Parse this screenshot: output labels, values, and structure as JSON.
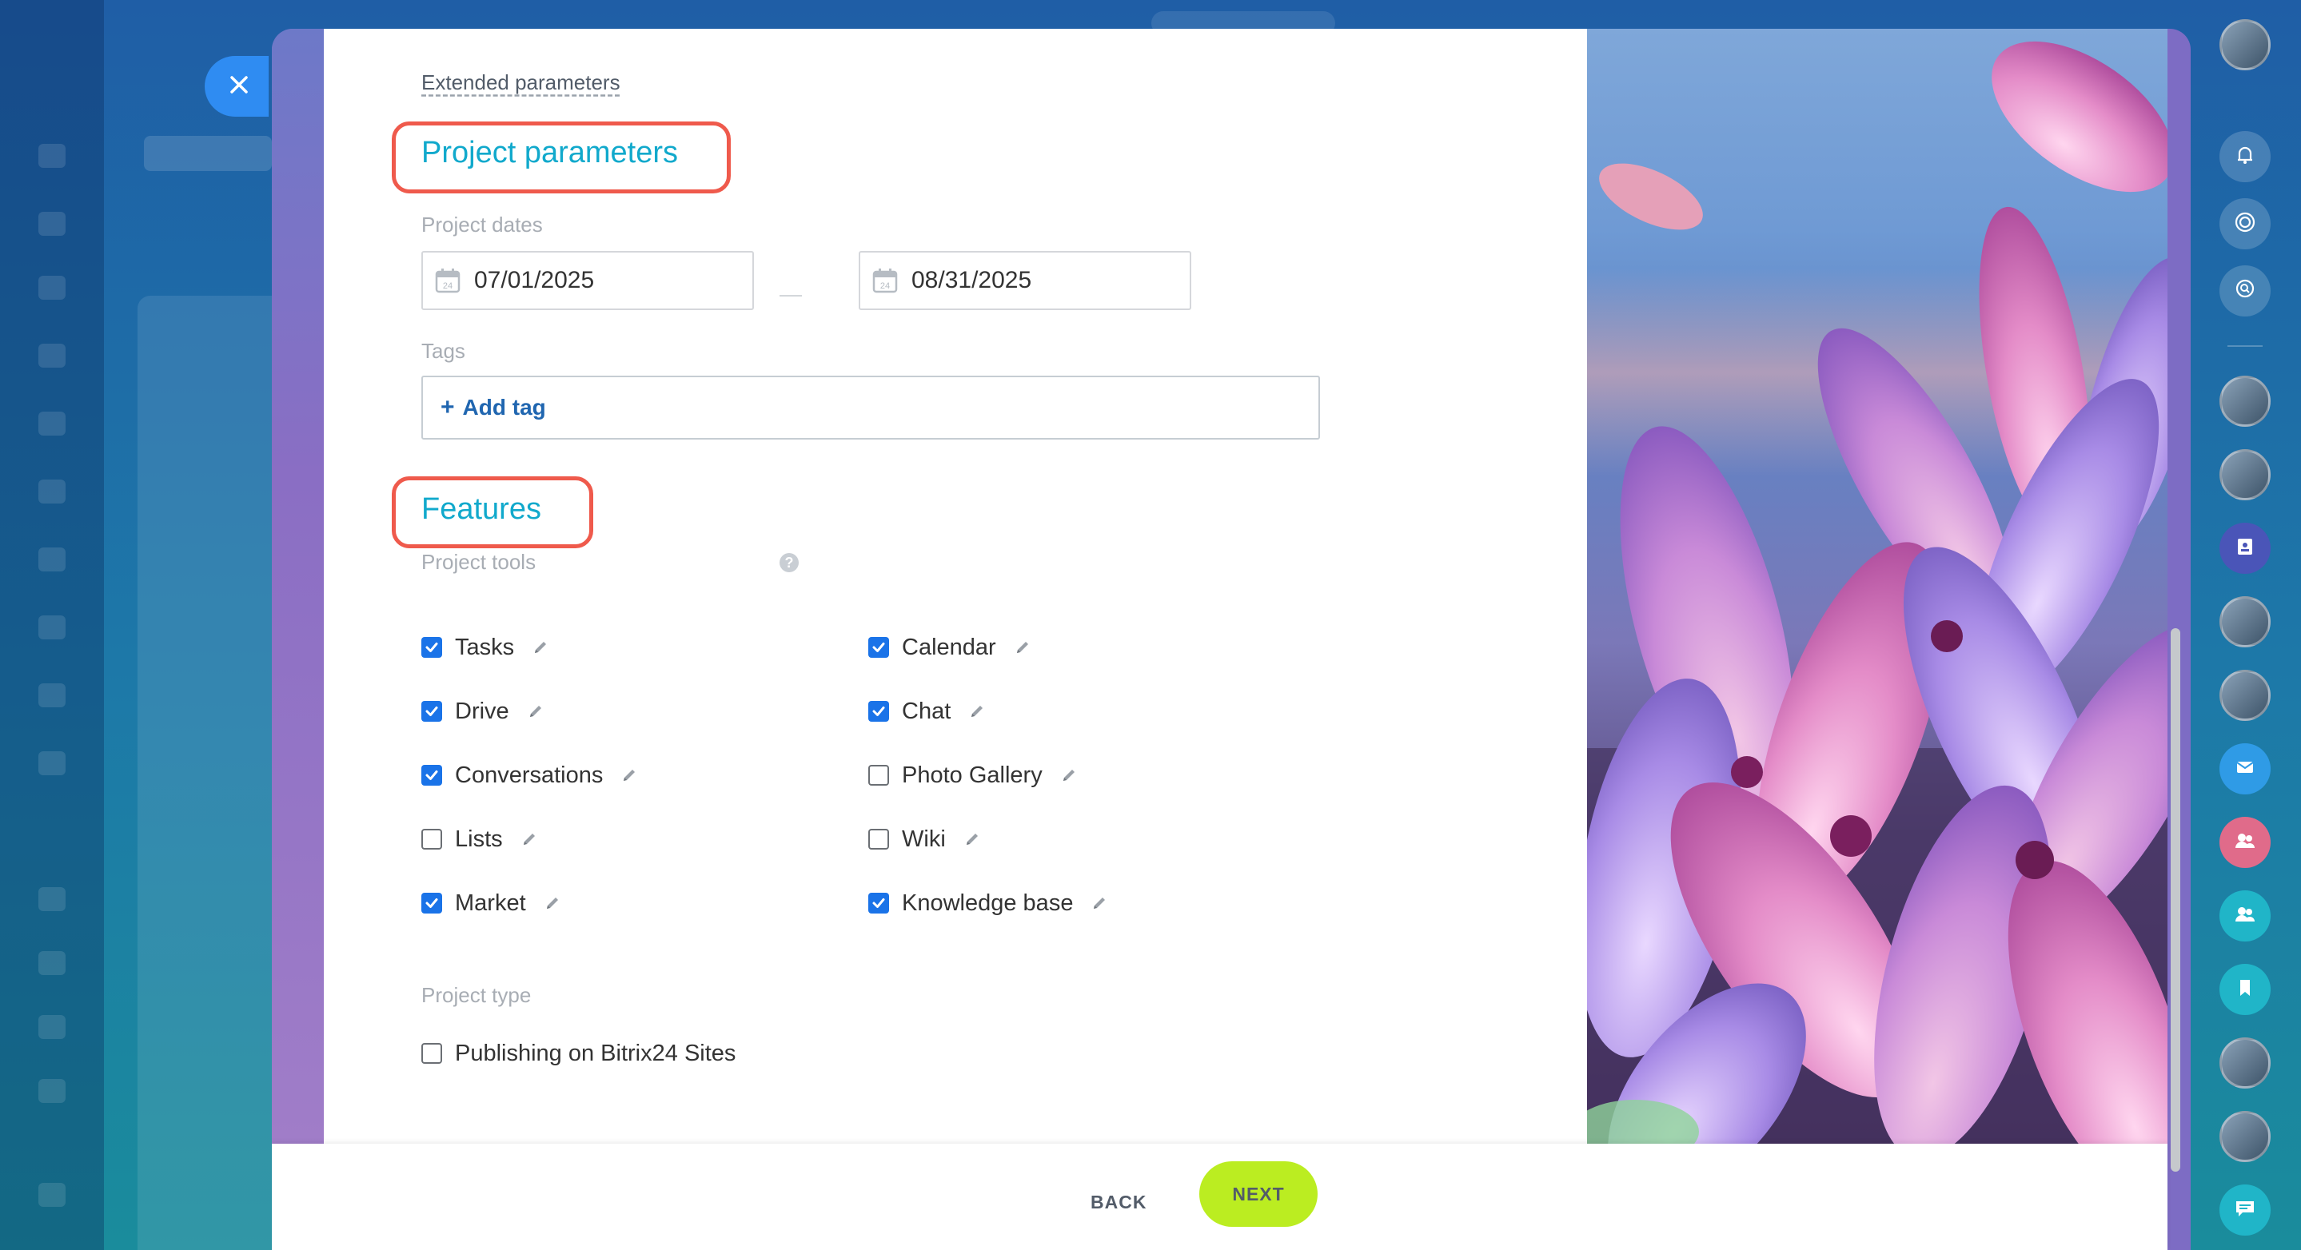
{
  "form": {
    "extended_parameters": "Extended parameters",
    "project_parameters_title": "Project parameters",
    "project_dates_label": "Project dates",
    "date_start": "07/01/2025",
    "date_end": "08/31/2025",
    "date_separator": "—",
    "tags_label": "Tags",
    "add_tag_plus": "+",
    "add_tag": "Add tag",
    "features_title": "Features",
    "project_tools_label": "Project tools",
    "help_icon_glyph": "?",
    "tools_left": [
      {
        "label": "Tasks",
        "checked": true
      },
      {
        "label": "Drive",
        "checked": true
      },
      {
        "label": "Conversations",
        "checked": true
      },
      {
        "label": "Lists",
        "checked": false
      },
      {
        "label": "Market",
        "checked": true
      }
    ],
    "tools_right": [
      {
        "label": "Calendar",
        "checked": true
      },
      {
        "label": "Chat",
        "checked": true
      },
      {
        "label": "Photo Gallery",
        "checked": false
      },
      {
        "label": "Wiki",
        "checked": false
      },
      {
        "label": "Knowledge base",
        "checked": true
      }
    ],
    "project_type_label": "Project type",
    "publishing_option": {
      "label": "Publishing on Bitrix24 Sites",
      "checked": false
    }
  },
  "footer": {
    "back_label": "BACK",
    "next_label": "NEXT"
  },
  "icons": {
    "close": "close-icon",
    "calendar": "calendar-icon",
    "pencil": "pencil-icon",
    "help": "help-icon",
    "bell": "bell-icon",
    "target": "target-icon",
    "search_chat": "search-chat-icon",
    "mail": "mail-icon",
    "group": "group-icon",
    "bookmark": "bookmark-icon",
    "chat": "chat-icon"
  },
  "colors": {
    "accent_title": "#11a9cc",
    "highlight": "#ef5a4c",
    "checkbox_on": "#1a73e8",
    "next_button": "#bbed21",
    "close_button": "#2f8cf2"
  }
}
